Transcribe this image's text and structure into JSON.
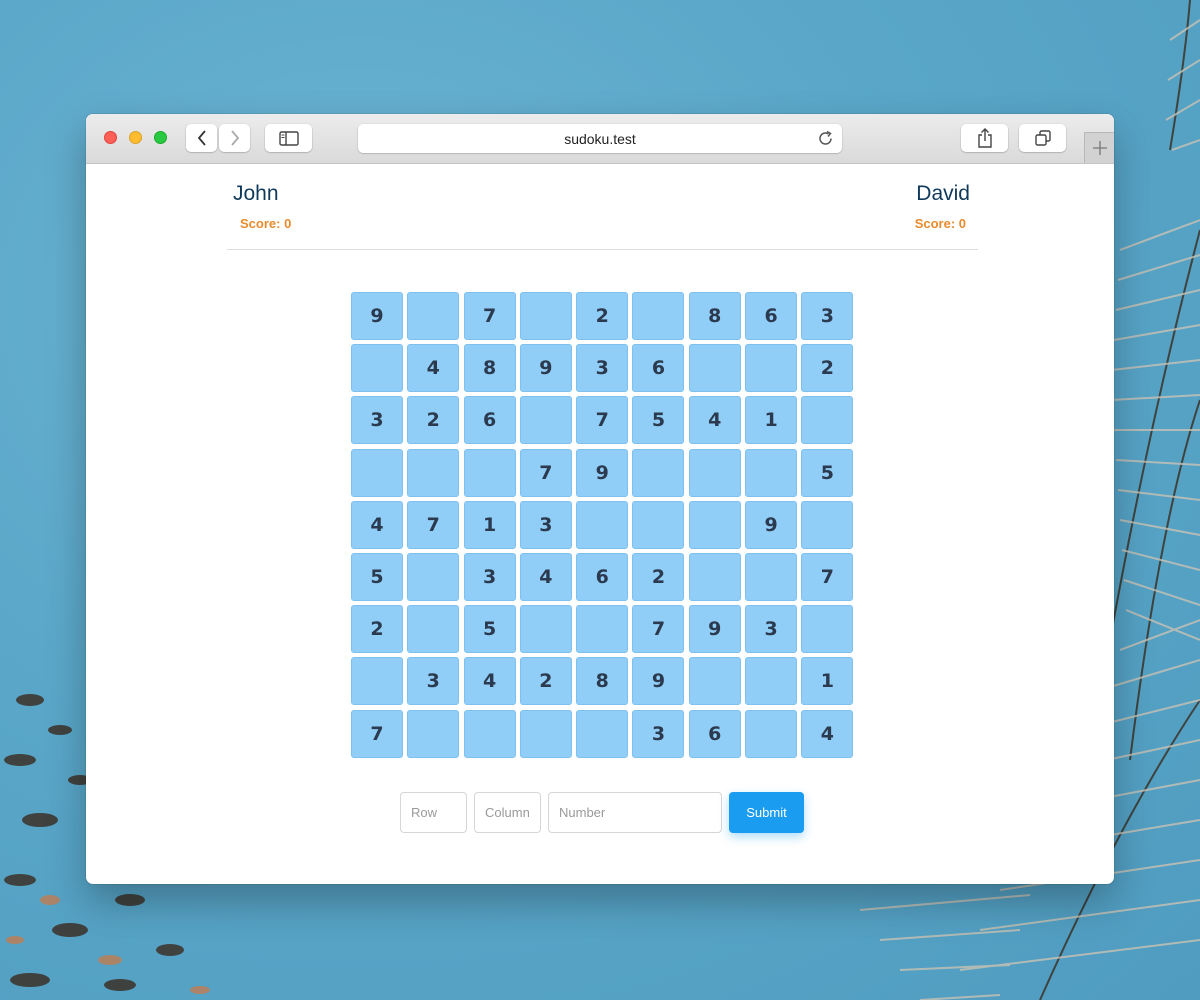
{
  "browser": {
    "url": "sudoku.test"
  },
  "players": [
    {
      "name": "John",
      "score_label": "Score: 0"
    },
    {
      "name": "David",
      "score_label": "Score: 0"
    }
  ],
  "board": [
    [
      "9",
      "",
      "7",
      "",
      "2",
      "",
      "8",
      "6",
      "3"
    ],
    [
      "",
      "4",
      "8",
      "9",
      "3",
      "6",
      "",
      "",
      "2"
    ],
    [
      "3",
      "2",
      "6",
      "",
      "7",
      "5",
      "4",
      "1",
      ""
    ],
    [
      "",
      "",
      "",
      "7",
      "9",
      "",
      "",
      "",
      "5"
    ],
    [
      "4",
      "7",
      "1",
      "3",
      "",
      "",
      "",
      "9",
      ""
    ],
    [
      "5",
      "",
      "3",
      "4",
      "6",
      "2",
      "",
      "",
      "7"
    ],
    [
      "2",
      "",
      "5",
      "",
      "",
      "7",
      "9",
      "3",
      ""
    ],
    [
      "",
      "3",
      "4",
      "2",
      "8",
      "9",
      "",
      "",
      "1"
    ],
    [
      "7",
      "",
      "",
      "",
      "",
      "3",
      "6",
      "",
      "4"
    ]
  ],
  "form": {
    "row_placeholder": "Row",
    "column_placeholder": "Column",
    "number_placeholder": "Number",
    "submit_label": "Submit"
  },
  "colors": {
    "cell": "#90cef7",
    "submit": "#1a9cf0",
    "player_name": "#0f3a5c",
    "score": "#e98a2c"
  }
}
